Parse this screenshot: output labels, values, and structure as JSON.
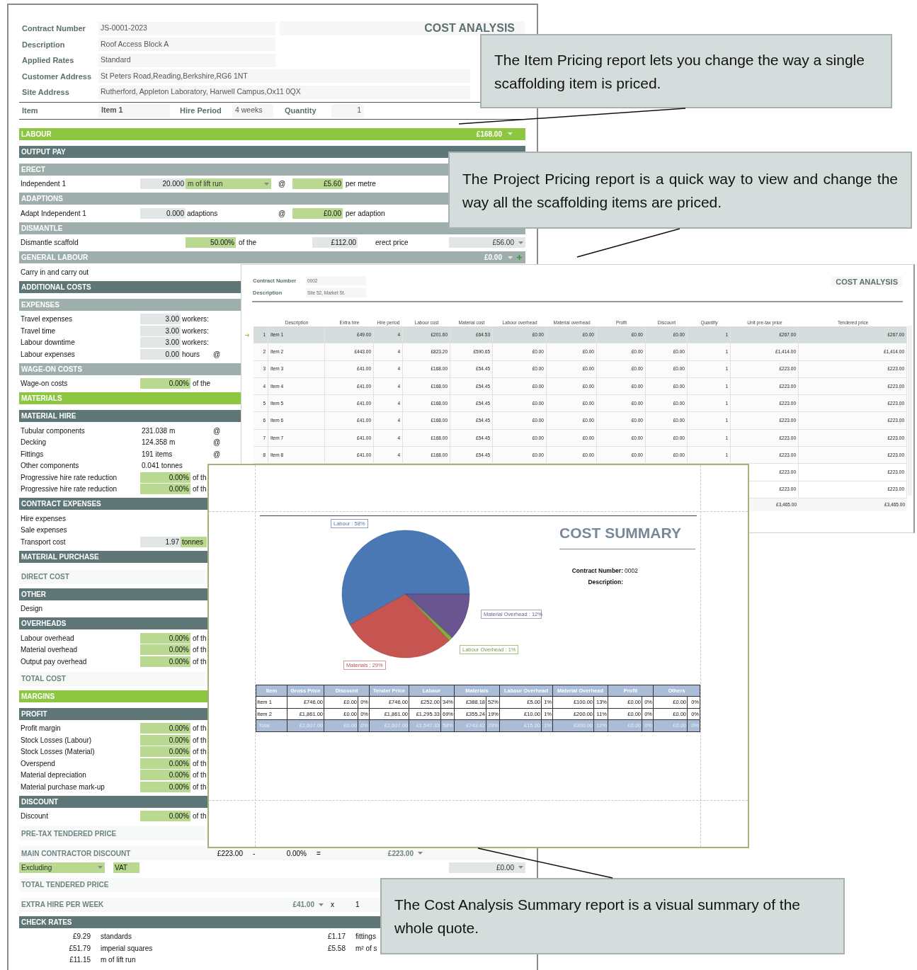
{
  "item_pricing": {
    "title": "COST ANALYSIS",
    "fields": [
      {
        "label": "Contract Number",
        "value": "JS-0001-2023"
      },
      {
        "label": "Description",
        "value": "Roof Access Block A"
      },
      {
        "label": "Applied Rates",
        "value": "Standard"
      },
      {
        "label": "Customer Address",
        "value": "St Peters Road,Reading,Berkshire,RG6 1NT"
      },
      {
        "label": "Site Address",
        "value": "Rutherford, Appleton Laboratory, Harwell Campus,Ox11 0QX"
      }
    ],
    "item_bar": [
      {
        "label": "Item",
        "value": "Item 1"
      },
      {
        "label": "Hire Period",
        "value": "4 weeks"
      },
      {
        "label": "Quantity",
        "value": "1"
      }
    ],
    "rows": [
      {
        "kind": "band",
        "color": "#8dc641",
        "label": "LABOUR",
        "value": "£168.00",
        "add": false
      },
      {
        "kind": "band",
        "color": "#5f7676",
        "label": "OUTPUT PAY"
      },
      {
        "kind": "band",
        "color": "#9eaead",
        "label": "ERECT"
      },
      {
        "kind": "line",
        "label": "Independent 1",
        "cells": [
          {
            "kind": "grey",
            "text": "20.000"
          },
          {
            "kind": "select_green",
            "text": "m of lift run"
          },
          {
            "kind": "at",
            "text": "@"
          },
          {
            "kind": "green",
            "text": "£5.60"
          },
          {
            "kind": "text",
            "text": "per metre"
          }
        ]
      },
      {
        "kind": "band",
        "color": "#9eaead",
        "label": "ADAPTIONS"
      },
      {
        "kind": "line",
        "label": "Adapt Independent 1",
        "cells": [
          {
            "kind": "grey",
            "text": "0.000"
          },
          {
            "kind": "text",
            "text": "adaptions"
          },
          {
            "kind": "at",
            "text": "@"
          },
          {
            "kind": "green",
            "text": "£0.00"
          },
          {
            "kind": "text",
            "text": "per adaption"
          }
        ]
      },
      {
        "kind": "band",
        "color": "#9eaead",
        "label": "DISMANTLE"
      },
      {
        "kind": "line",
        "label": "Dismantle scaffold",
        "cells": [
          {
            "kind": "green",
            "text": "50.00%"
          },
          {
            "kind": "text",
            "text": "of the"
          },
          {
            "kind": "grey",
            "text": "£112.00"
          },
          {
            "kind": "text",
            "text": "erect price"
          },
          {
            "kind": "select_grey",
            "text": "£56.00"
          }
        ]
      },
      {
        "kind": "band",
        "color": "#9eaead",
        "label": "GENERAL LABOUR",
        "value": "£0.00",
        "add": true
      },
      {
        "kind": "line",
        "label": "Carry in and carry out",
        "cells": []
      },
      {
        "kind": "band",
        "color": "#5f7676",
        "label": "ADDITIONAL COSTS"
      },
      {
        "kind": "band",
        "color": "#9eaead",
        "label": "EXPENSES"
      },
      {
        "kind": "line",
        "label": "Travel expenses",
        "cells": [
          {
            "kind": "grey",
            "text": "3.00"
          },
          {
            "kind": "text",
            "text": "workers:"
          }
        ]
      },
      {
        "kind": "line",
        "label": "Travel time",
        "cells": [
          {
            "kind": "grey",
            "text": "3.00"
          },
          {
            "kind": "text",
            "text": "workers:"
          }
        ]
      },
      {
        "kind": "line",
        "label": "Labour downtime",
        "cells": [
          {
            "kind": "grey",
            "text": "3.00"
          },
          {
            "kind": "text",
            "text": "workers:"
          }
        ]
      },
      {
        "kind": "line",
        "label": "Labour expenses",
        "cells": [
          {
            "kind": "grey",
            "text": "0.00"
          },
          {
            "kind": "text",
            "text": "hours"
          },
          {
            "kind": "at",
            "text": "@"
          }
        ]
      },
      {
        "kind": "band",
        "color": "#9eaead",
        "label": "WAGE-ON COSTS"
      },
      {
        "kind": "line",
        "label": "Wage-on costs",
        "cells": [
          {
            "kind": "green",
            "text": "0.00%"
          },
          {
            "kind": "text",
            "text": "of the"
          }
        ]
      },
      {
        "kind": "band",
        "color": "#8dc641",
        "label": "MATERIALS"
      },
      {
        "kind": "band",
        "color": "#5f7676",
        "label": "MATERIAL HIRE"
      },
      {
        "kind": "line",
        "label": "Tubular components",
        "cells": [
          {
            "kind": "text",
            "text": "231.038 m"
          },
          {
            "kind": "at",
            "text": "@"
          }
        ]
      },
      {
        "kind": "line",
        "label": "Decking",
        "cells": [
          {
            "kind": "text",
            "text": "124.358 m"
          },
          {
            "kind": "at",
            "text": "@"
          }
        ]
      },
      {
        "kind": "line",
        "label": "Fittings",
        "cells": [
          {
            "kind": "text",
            "text": "191 items"
          },
          {
            "kind": "at",
            "text": "@"
          }
        ]
      },
      {
        "kind": "line",
        "label": "Other components",
        "cells": [
          {
            "kind": "text",
            "text": "0.041 tonnes"
          }
        ]
      },
      {
        "kind": "line",
        "label": "Progressive hire rate reduction",
        "cells": [
          {
            "kind": "green",
            "text": "0.00%"
          },
          {
            "kind": "text",
            "text": "of th"
          }
        ]
      },
      {
        "kind": "line",
        "label": "Progressive hire rate reduction",
        "cells": [
          {
            "kind": "green",
            "text": "0.00%"
          },
          {
            "kind": "text",
            "text": "of th"
          }
        ]
      },
      {
        "kind": "band",
        "color": "#5f7676",
        "label": "CONTRACT EXPENSES"
      },
      {
        "kind": "line",
        "label": "Hire expenses",
        "cells": []
      },
      {
        "kind": "line",
        "label": "Sale expenses",
        "cells": []
      },
      {
        "kind": "line",
        "label": "Transport cost",
        "cells": [
          {
            "kind": "grey",
            "text": "1.97"
          },
          {
            "kind": "unit_green",
            "text": "tonnes"
          }
        ]
      },
      {
        "kind": "band",
        "color": "#5f7676",
        "label": "MATERIAL PURCHASE"
      },
      {
        "kind": "title",
        "label": "DIRECT COST",
        "cells": []
      },
      {
        "kind": "band",
        "color": "#5f7676",
        "label": "OTHER"
      },
      {
        "kind": "line",
        "label": "Design",
        "cells": []
      },
      {
        "kind": "band",
        "color": "#5f7676",
        "label": "OVERHEADS"
      },
      {
        "kind": "line",
        "label": "Labour overhead",
        "cells": [
          {
            "kind": "green",
            "text": "0.00%"
          },
          {
            "kind": "text",
            "text": "of th"
          }
        ]
      },
      {
        "kind": "line",
        "label": "Material overhead",
        "cells": [
          {
            "kind": "green",
            "text": "0.00%"
          },
          {
            "kind": "text",
            "text": "of th"
          }
        ]
      },
      {
        "kind": "line",
        "label": "Output pay overhead",
        "cells": [
          {
            "kind": "green",
            "text": "0.00%"
          },
          {
            "kind": "text",
            "text": "of th"
          }
        ]
      },
      {
        "kind": "title",
        "label": "TOTAL COST",
        "cells": []
      },
      {
        "kind": "band",
        "color": "#8dc641",
        "label": "MARGINS"
      },
      {
        "kind": "band",
        "color": "#5f7676",
        "label": "PROFIT"
      },
      {
        "kind": "line",
        "label": "Profit margin",
        "cells": [
          {
            "kind": "green",
            "text": "0.00%"
          },
          {
            "kind": "text",
            "text": "of th"
          }
        ]
      },
      {
        "kind": "line",
        "label": "Stock Losses (Labour)",
        "cells": [
          {
            "kind": "green",
            "text": "0.00%"
          },
          {
            "kind": "text",
            "text": "of th"
          }
        ]
      },
      {
        "kind": "line",
        "label": "Stock Losses (Material)",
        "cells": [
          {
            "kind": "green",
            "text": "0.00%"
          },
          {
            "kind": "text",
            "text": "of th"
          }
        ]
      },
      {
        "kind": "line",
        "label": "Overspend",
        "cells": [
          {
            "kind": "green",
            "text": "0.00%"
          },
          {
            "kind": "text",
            "text": "of th"
          }
        ]
      },
      {
        "kind": "line",
        "label": "Material depreciation",
        "cells": [
          {
            "kind": "green",
            "text": "0.00%"
          },
          {
            "kind": "text",
            "text": "of th"
          }
        ]
      },
      {
        "kind": "line",
        "label": "Material purchase mark-up",
        "cells": [
          {
            "kind": "green",
            "text": "0.00%"
          },
          {
            "kind": "text",
            "text": "of th"
          }
        ]
      },
      {
        "kind": "band",
        "color": "#5f7676",
        "label": "DISCOUNT"
      },
      {
        "kind": "line",
        "label": "Discount",
        "cells": [
          {
            "kind": "green",
            "text": "0.00%"
          },
          {
            "kind": "text",
            "text": "of th"
          }
        ]
      },
      {
        "kind": "title",
        "label": "PRE-TAX TENDERED PRICE",
        "cells": []
      },
      {
        "kind": "title",
        "label": "MAIN CONTRACTOR DISCOUNT",
        "cells": [
          {
            "kind": "text_right",
            "text": "£223.00"
          },
          {
            "kind": "text",
            "text": "-"
          },
          {
            "kind": "text_right",
            "text": "0.00%"
          },
          {
            "kind": "text",
            "text": "="
          },
          {
            "kind": "select_plain",
            "text": "£223.00"
          }
        ]
      },
      {
        "kind": "line",
        "cells": [
          {
            "kind": "select_green",
            "text": "Excluding"
          },
          {
            "kind": "unit_green",
            "text": "VAT"
          },
          {
            "kind": "select_grey",
            "text": "£0.00"
          }
        ]
      },
      {
        "kind": "title",
        "label": "TOTAL TENDERED PRICE",
        "cells": []
      },
      {
        "kind": "title",
        "label": "EXTRA HIRE PER WEEK",
        "cells": [
          {
            "kind": "select_plain",
            "text": "£41.00"
          },
          {
            "kind": "text",
            "text": "x"
          },
          {
            "kind": "text",
            "text": "1"
          }
        ]
      },
      {
        "kind": "band",
        "color": "#5f7676",
        "label": "CHECK RATES"
      },
      {
        "kind": "line",
        "cells": [
          {
            "kind": "text_right",
            "text": "£9.29"
          },
          {
            "kind": "text",
            "text": "standards"
          },
          {
            "kind": "text_right",
            "text": "£1.17"
          },
          {
            "kind": "text",
            "text": "fittings"
          }
        ]
      },
      {
        "kind": "line",
        "cells": [
          {
            "kind": "text_right",
            "text": "£51.79"
          },
          {
            "kind": "text",
            "text": "imperial squares"
          },
          {
            "kind": "text_right",
            "text": "£5.58"
          },
          {
            "kind": "text",
            "text": "m² of s"
          }
        ]
      },
      {
        "kind": "line",
        "cells": [
          {
            "kind": "text_right",
            "text": "£11.15"
          },
          {
            "kind": "text",
            "text": "m of lift run"
          }
        ]
      }
    ]
  },
  "project_pricing": {
    "title": "COST ANALYSIS",
    "fields": [
      {
        "label": "Contract Number",
        "value": "0002"
      },
      {
        "label": "Description",
        "value": "Site 52, Market St."
      }
    ],
    "columns": [
      "Description",
      "Extra hire",
      "Hire period",
      "Labour cost",
      "Material cost",
      "Labour overhead",
      "Material overhead",
      "Profit",
      "Discount",
      "Quantity",
      "Unit pre-tax price",
      "Tendered price"
    ],
    "rows": [
      {
        "number": "1",
        "selected": true,
        "cells": [
          "Item 1",
          "£49.00",
          "4",
          "£201.60",
          "£64.53",
          "£0.00",
          "£0.00",
          "£0.00",
          "£0.00",
          "1",
          "£267.00",
          "£267.00"
        ]
      },
      {
        "number": "2",
        "selected": false,
        "cells": [
          "Item 2",
          "£443.00",
          "4",
          "£823.20",
          "£590.65",
          "£0.00",
          "£0.00",
          "£0.00",
          "£0.00",
          "1",
          "£1,414.00",
          "£1,414.00"
        ]
      },
      {
        "number": "3",
        "selected": false,
        "cells": [
          "Item 3",
          "£41.00",
          "4",
          "£168.00",
          "£54.45",
          "£0.00",
          "£0.00",
          "£0.00",
          "£0.00",
          "1",
          "£223.00",
          "£223.00"
        ]
      },
      {
        "number": "4",
        "selected": false,
        "cells": [
          "Item 4",
          "£41.00",
          "4",
          "£168.00",
          "£54.45",
          "£0.00",
          "£0.00",
          "£0.00",
          "£0.00",
          "1",
          "£223.00",
          "£223.00"
        ]
      },
      {
        "number": "5",
        "selected": false,
        "cells": [
          "Item 5",
          "£41.00",
          "4",
          "£168.00",
          "£54.45",
          "£0.00",
          "£0.00",
          "£0.00",
          "£0.00",
          "1",
          "£223.00",
          "£223.00"
        ]
      },
      {
        "number": "6",
        "selected": false,
        "cells": [
          "Item 6",
          "£41.00",
          "4",
          "£168.00",
          "£54.45",
          "£0.00",
          "£0.00",
          "£0.00",
          "£0.00",
          "1",
          "£223.00",
          "£223.00"
        ]
      },
      {
        "number": "7",
        "selected": false,
        "cells": [
          "Item 7",
          "£41.00",
          "4",
          "£168.00",
          "£54.45",
          "£0.00",
          "£0.00",
          "£0.00",
          "£0.00",
          "1",
          "£223.00",
          "£223.00"
        ]
      },
      {
        "number": "8",
        "selected": false,
        "cells": [
          "Item 8",
          "£41.00",
          "4",
          "£168.00",
          "£54.45",
          "£0.00",
          "£0.00",
          "£0.00",
          "£0.00",
          "1",
          "£223.00",
          "£223.00"
        ]
      }
    ],
    "more_rows": [
      {
        "unit_price": "£223.00",
        "tendered_price": "£223.00"
      },
      {
        "unit_price": "£223.00",
        "tendered_price": "£223.00"
      }
    ],
    "totals": {
      "unit_price": "£3,465.00",
      "tendered_price": "£3,465.00"
    }
  },
  "cost_summary": {
    "title": "COST SUMMARY",
    "fields": [
      {
        "label": "Contract Number:",
        "value": "0002"
      },
      {
        "label": "Description:"
      }
    ],
    "chart_data": {
      "type": "pie",
      "values": [
        58,
        29,
        1,
        12
      ],
      "value_labels": [
        "Labour : 58%",
        "Materials : 29%",
        "Labour Overhead : 1%",
        "Material Overhead : 12%"
      ]
    },
    "table": {
      "columns": [
        "Item",
        "Gross Price",
        "Discount",
        "Tender Price",
        "Labour",
        "Materials",
        "Labour Overhead",
        "Material Overhead",
        "Profit",
        "Others"
      ],
      "rows": [
        {
          "kind": "item",
          "cells": [
            "Item 1",
            "£746.00",
            {
              "amount": "£0.00",
              "share": "0%"
            },
            "£746.00",
            {
              "amount": "£252.00",
              "share": "34%"
            },
            {
              "amount": "£388.18",
              "share": "52%"
            },
            {
              "amount": "£5.00",
              "share": "1%"
            },
            {
              "amount": "£100.00",
              "share": "13%"
            },
            {
              "amount": "£0.00",
              "share": "0%"
            },
            {
              "amount": "£0.00",
              "share": "0%"
            }
          ]
        },
        {
          "kind": "item",
          "cells": [
            "Item 2",
            "£1,861.00",
            {
              "amount": "£0.00",
              "share": "0%"
            },
            "£1,861.00",
            {
              "amount": "£1,295.33",
              "share": "69%"
            },
            {
              "amount": "£355.24",
              "share": "19%"
            },
            {
              "amount": "£10.00",
              "share": "1%"
            },
            {
              "amount": "£200.00",
              "share": "11%"
            },
            {
              "amount": "£0.00",
              "share": "0%"
            },
            {
              "amount": "£0.00",
              "share": "0%"
            }
          ]
        },
        {
          "kind": "total",
          "cells": [
            "Total :",
            "£2,607.00",
            {
              "amount": "£0.00",
              "share": "0%"
            },
            "£2,607.00",
            {
              "amount": "£1,547.33",
              "share": "58%"
            },
            {
              "amount": "£743.42",
              "share": "29%"
            },
            {
              "amount": "£15.00",
              "share": "1%"
            },
            {
              "amount": "£300.00",
              "share": "12%"
            },
            {
              "amount": "£0.00",
              "share": "0%"
            },
            {
              "amount": "£0.00",
              "share": "0%"
            }
          ]
        }
      ]
    }
  },
  "callouts": [
    {
      "text": "The Item Pricing report lets you change the way a single scaffolding item is priced."
    },
    {
      "text": "The Project Pricing report is a quick way to view and change the way all the scaffolding items are priced."
    },
    {
      "text": "The Cost Analysis Summary report is a visual summary of the whole quote."
    }
  ]
}
